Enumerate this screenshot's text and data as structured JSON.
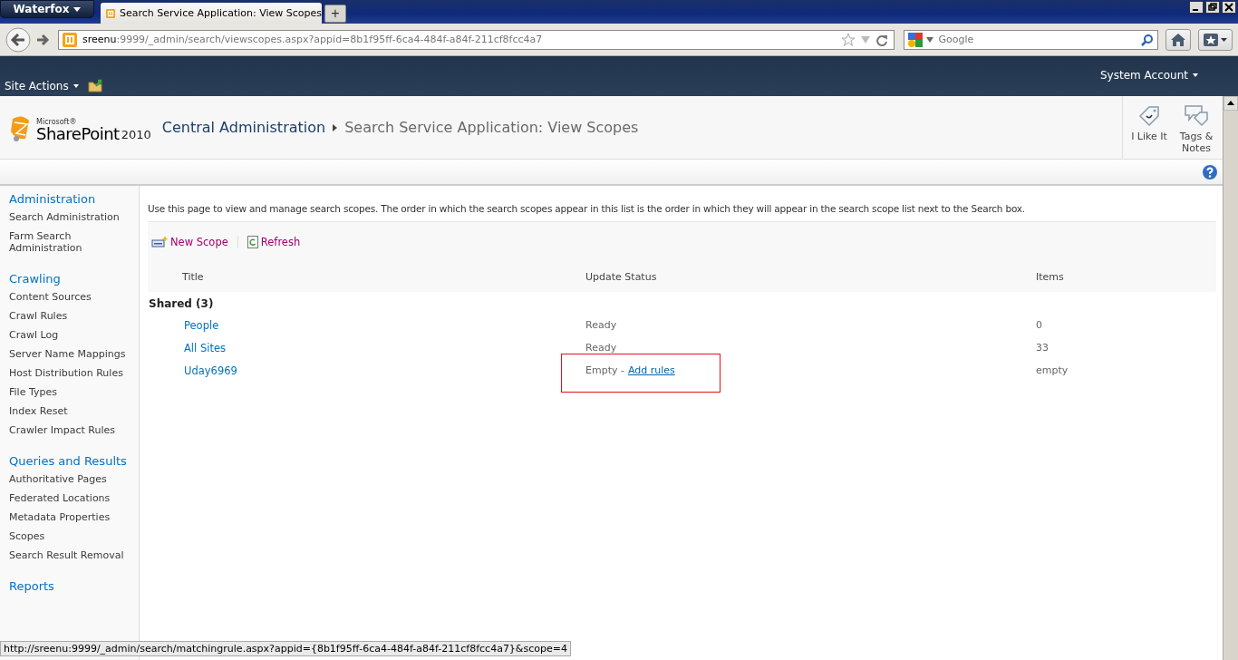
{
  "browser": {
    "app_menu": "Waterfox",
    "tab_title": "Search Service Application: View Scopes",
    "new_tab": "+",
    "url_host": "sreenu",
    "url_path": ":9999/_admin/search/viewscopes.aspx?appid=8b1f95ff-6ca4-484f-a84f-211cf8fcc4a7",
    "search_placeholder": "Google"
  },
  "topbar": {
    "site_actions": "Site Actions",
    "account": "System Account"
  },
  "header": {
    "brand_small": "Microsoft®",
    "brand": "SharePoint",
    "brand_year": "2010",
    "breadcrumb_root": "Central Administration",
    "page_title": "Search Service Application: View Scopes",
    "actions": [
      {
        "label": "I Like It",
        "kind": "like"
      },
      {
        "label": "Tags & Notes",
        "kind": "tags"
      }
    ]
  },
  "sidebar": [
    {
      "heading": "Administration",
      "items": [
        "Search Administration",
        "Farm Search Administration"
      ]
    },
    {
      "heading": "Crawling",
      "items": [
        "Content Sources",
        "Crawl Rules",
        "Crawl Log",
        "Server Name Mappings",
        "Host Distribution Rules",
        "File Types",
        "Index Reset",
        "Crawler Impact Rules"
      ]
    },
    {
      "heading": "Queries and Results",
      "items": [
        "Authoritative Pages",
        "Federated Locations",
        "Metadata Properties",
        "Scopes",
        "Search Result Removal"
      ]
    },
    {
      "heading": "Reports"
    }
  ],
  "intro": "Use this page to view and manage search scopes. The order in which the search scopes appear in this list is the order in which they will appear in the search scope list next to the Search box.",
  "toolbar": [
    {
      "label": "New Scope",
      "kind": "new"
    },
    {
      "label": "Refresh",
      "kind": "refresh"
    }
  ],
  "table": {
    "columns": [
      "Title",
      "Update Status",
      "Items"
    ],
    "group": "Shared (3)",
    "rows": [
      {
        "title": "People",
        "status": "Ready",
        "items": "0",
        "highlighted": false
      },
      {
        "title": "All Sites",
        "status": "Ready",
        "items": "33",
        "highlighted": false
      },
      {
        "title": "Uday6969",
        "status": "Empty -",
        "status_link": "Add rules",
        "items": "empty",
        "highlighted": true
      }
    ]
  },
  "status_bar": "http://sreenu:9999/_admin/search/matchingrule.aspx?appid={8b1f95ff-6ca4-484f-a84f-211cf8fcc4a7}&scope=4"
}
